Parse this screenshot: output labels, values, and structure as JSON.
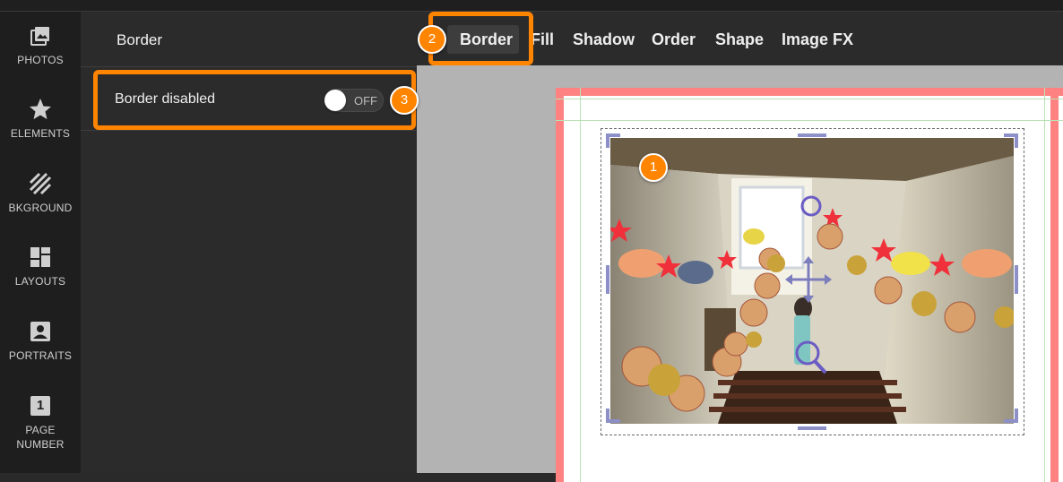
{
  "sidebar": {
    "items": [
      {
        "label": "PHOTOS",
        "icon": "photos-icon"
      },
      {
        "label": "ELEMENTS",
        "icon": "star-icon"
      },
      {
        "label": "BKGROUND",
        "icon": "background-stripes-icon"
      },
      {
        "label": "LAYOUTS",
        "icon": "layouts-icon"
      },
      {
        "label": "PORTRAITS",
        "icon": "portrait-icon"
      },
      {
        "label": "PAGE NUMBER",
        "icon": "page-number-icon",
        "icon_text": "1"
      }
    ]
  },
  "panel": {
    "title": "Border",
    "row_label": "Border disabled",
    "toggle_state": "OFF"
  },
  "toolbar": {
    "tabs": [
      "Border",
      "Fill",
      "Shadow",
      "Order",
      "Shape",
      "Image FX"
    ],
    "active_tab": "Border"
  },
  "annotations": [
    "1",
    "2",
    "3"
  ],
  "colors": {
    "accent": "#ff8400",
    "bleed": "#ff8282",
    "guide": "#b9e2b5",
    "handle": "#8c8fc8",
    "rail_bg": "#1e1e1e",
    "panel_bg": "#2b2b2b",
    "workspace_bg": "#b3b3b3"
  }
}
